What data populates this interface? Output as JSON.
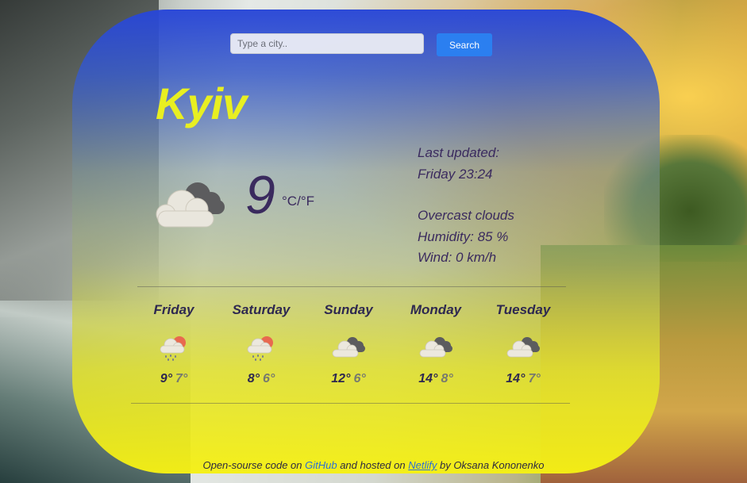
{
  "search": {
    "placeholder": "Type a city..",
    "button_label": "Search"
  },
  "current": {
    "city": "Kyiv",
    "temperature": "9",
    "unit_celsius": "°C",
    "unit_separator": "/",
    "unit_fahrenheit": "°F",
    "icon": "cloudy-icon",
    "last_updated_label": "Last updated:",
    "last_updated_value": "Friday 23:24",
    "description": "Overcast clouds",
    "humidity": "Humidity: 85 %",
    "wind": "Wind: 0 km/h"
  },
  "forecast": [
    {
      "day": "Friday",
      "max": "9°",
      "min": "7°",
      "icon": "rain-sun-icon"
    },
    {
      "day": "Saturday",
      "max": "8°",
      "min": "6°",
      "icon": "rain-sun-icon"
    },
    {
      "day": "Sunday",
      "max": "12°",
      "min": "6°",
      "icon": "cloudy-icon"
    },
    {
      "day": "Monday",
      "max": "14°",
      "min": "8°",
      "icon": "cloudy-icon"
    },
    {
      "day": "Tuesday",
      "max": "14°",
      "min": "7°",
      "icon": "cloudy-icon"
    }
  ],
  "footer": {
    "prefix": "Open-sourse code on ",
    "github_label": "GitHub",
    "middle": " and hosted on ",
    "netlify_label": "Netlify",
    "suffix": " by Oksana Kononenko"
  },
  "colors": {
    "city": "#e8ef21",
    "text": "#3a2a5e",
    "button": "#2b7ff0",
    "link": "#2b6fd6"
  }
}
